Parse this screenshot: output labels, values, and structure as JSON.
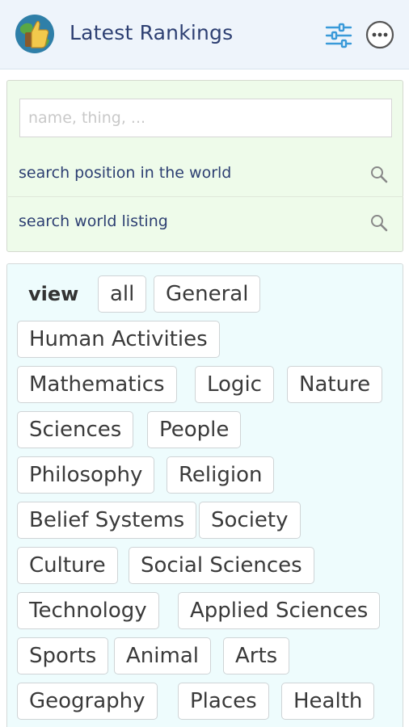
{
  "header": {
    "title": "Latest Rankings",
    "logo_icon": "thumbs-up-globe-icon",
    "filter_icon": "sliders-icon",
    "more_icon": "more-dots-icon"
  },
  "search": {
    "placeholder": "name, thing, ...",
    "value": "",
    "options": [
      {
        "label": "search position in the world",
        "icon": "search-icon"
      },
      {
        "label": "search world listing",
        "icon": "search-icon"
      }
    ]
  },
  "categories": {
    "view_label": "view",
    "chips": [
      "all",
      "General",
      "Human Activities",
      "Mathematics",
      "Logic",
      "Nature",
      "Sciences",
      "People",
      "Philosophy",
      "Religion",
      "Belief Systems",
      "Society",
      "Culture",
      "Social Sciences",
      "Technology",
      "Applied Sciences",
      "Sports",
      "Animal",
      "Arts",
      "Geography",
      "Places",
      "Health"
    ]
  },
  "colors": {
    "header_bg": "#eef4fb",
    "title_color": "#2d3f72",
    "search_panel_bg": "#eefbea",
    "view_panel_bg": "#eefcfd",
    "icon_blue": "#3a9ad9"
  }
}
